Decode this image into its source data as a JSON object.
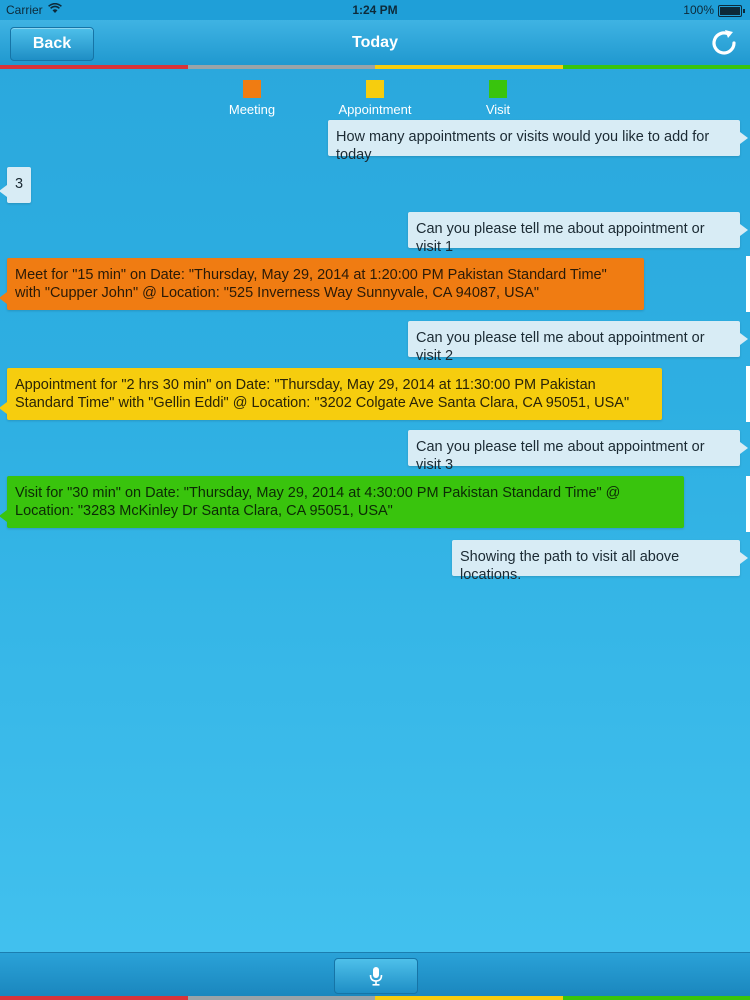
{
  "status_bar": {
    "carrier": "Carrier",
    "wifi_icon": "wifi-icon",
    "time": "1:24 PM",
    "battery": "100%"
  },
  "nav": {
    "back_label": "Back",
    "title": "Today",
    "refresh_icon": "refresh-icon"
  },
  "colors": {
    "meeting": "#f07c12",
    "appointment": "#f6cd0e",
    "visit": "#39c40d",
    "red_strip": "#d8343a",
    "gray_strip": "#9aa3a8"
  },
  "legend": [
    {
      "label": "Meeting",
      "color": "#f07c12"
    },
    {
      "label": "Appointment",
      "color": "#f6cd0e"
    },
    {
      "label": "Visit",
      "color": "#39c40d"
    }
  ],
  "messages": [
    {
      "side": "right",
      "style": "plain",
      "text": "How many appointments or visits would you like to add for today"
    },
    {
      "side": "left",
      "style": "plain",
      "text": "3"
    },
    {
      "side": "right",
      "style": "plain",
      "text": "Can you please tell me about appointment or visit 1"
    },
    {
      "side": "left",
      "style": "orange",
      "text": "Meet  for \"15 min\" on Date: \"Thursday, May 29, 2014 at 1:20:00 PM Pakistan Standard Time\" with \"Cupper John\" @ Location: \"525 Inverness Way Sunnyvale, CA 94087, USA\""
    },
    {
      "side": "right",
      "style": "plain",
      "text": "Can you please tell me about appointment or visit 2"
    },
    {
      "side": "left",
      "style": "yellow",
      "text": "Appointment for \"2 hrs 30 min\" on Date: \"Thursday, May 29, 2014 at 11:30:00 PM Pakistan Standard Time\" with \"Gellin Eddi\" @ Location: \"3202 Colgate Ave Santa Clara, CA 95051, USA\""
    },
    {
      "side": "right",
      "style": "plain",
      "text": "Can you please tell me about appointment or visit 3"
    },
    {
      "side": "left",
      "style": "green",
      "text": "Visit for \"30 min\" on Date: \"Thursday, May 29, 2014 at 4:30:00 PM Pakistan Standard Time\" @ Location: \"3283 McKinley Dr Santa Clara, CA 95051, USA\""
    },
    {
      "side": "right",
      "style": "plain",
      "text": "Showing the path to visit all above locations."
    }
  ],
  "bottom": {
    "mic_icon": "microphone-icon"
  }
}
